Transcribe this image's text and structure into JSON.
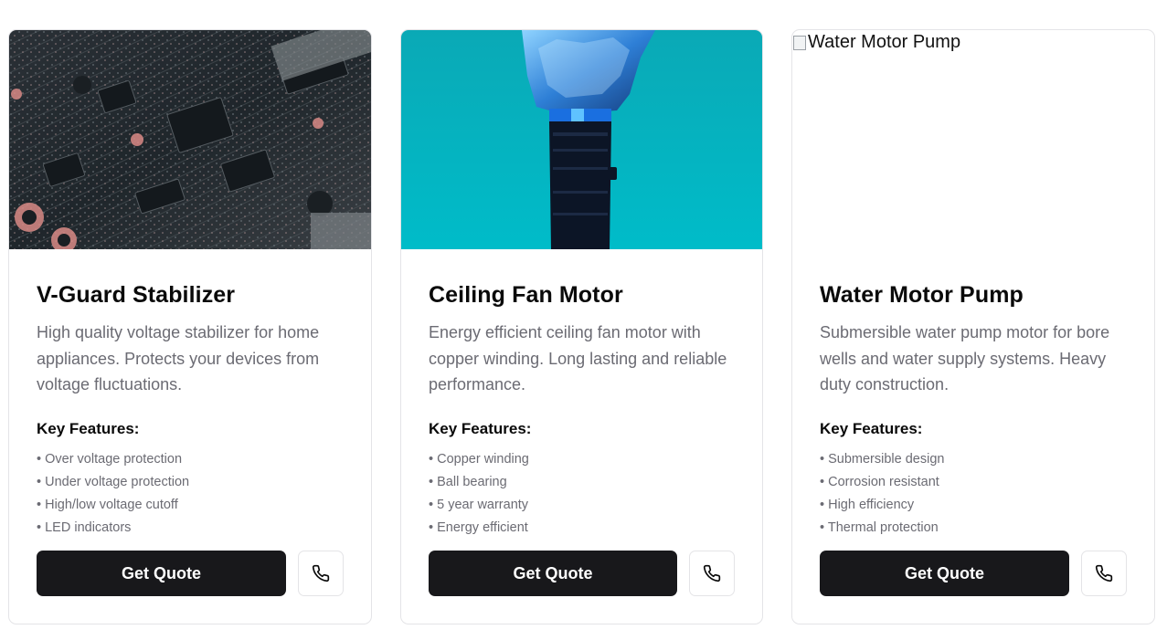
{
  "products": [
    {
      "title": "V-Guard Stabilizer",
      "description": "High quality voltage stabilizer for home appliances. Protects your devices from voltage fluctuations.",
      "features_heading": "Key Features:",
      "features": [
        "Over voltage protection",
        "Under voltage protection",
        "High/low voltage cutoff",
        "LED indicators"
      ],
      "cta_label": "Get Quote",
      "image": "circuit-board-photo",
      "call_icon": "phone-icon"
    },
    {
      "title": "Ceiling Fan Motor",
      "description": "Energy efficient ceiling fan motor with copper winding. Long lasting and reliable performance.",
      "features_heading": "Key Features:",
      "features": [
        "Copper winding",
        "Ball bearing",
        "5 year warranty",
        "Energy efficient"
      ],
      "cta_label": "Get Quote",
      "image": "robotic-hand-photo",
      "call_icon": "phone-icon"
    },
    {
      "title": "Water Motor Pump",
      "description": "Submersible water pump motor for bore wells and water supply systems. Heavy duty construction.",
      "features_heading": "Key Features:",
      "features": [
        "Submersible design",
        "Corrosion resistant",
        "High efficiency",
        "Thermal protection"
      ],
      "cta_label": "Get Quote",
      "image_alt": "Water Motor Pump",
      "call_icon": "phone-icon"
    }
  ],
  "colors": {
    "button_bg": "#18181b",
    "teal_bg": "#00b5c4",
    "muted_text": "#6b6b73",
    "border": "#e4e4e7"
  }
}
